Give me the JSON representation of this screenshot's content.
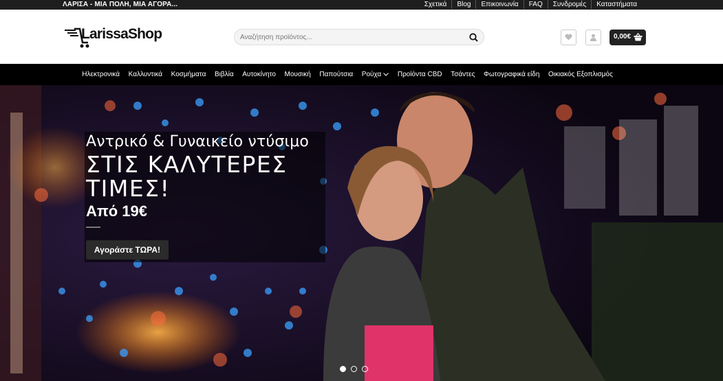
{
  "topbar": {
    "tagline": "ΛΑΡΙΣΑ - ΜΙΑ ΠΟΛΗ, ΜΙΑ ΑΓΟΡΑ...",
    "links": [
      "Σχετικά",
      "Blog",
      "Επικοινωνία",
      "FAQ",
      "Συνδρομές",
      "Καταστήματα"
    ]
  },
  "header": {
    "logo_text": "LarissaShop",
    "search_placeholder": "Αναζήτηση προϊόντος...",
    "cart_total": "0,00€"
  },
  "nav": {
    "items": [
      "Ηλεκτρονικά",
      "Καλλυντικά",
      "Κοσμήματα",
      "Βιβλία",
      "Αυτοκίνητο",
      "Μουσική",
      "Παπούτσια",
      "Ρούχα",
      "Προϊόντα CBD",
      "Τσάντες",
      "Φωτογραφικά είδη",
      "Οικιακός Εξοπλισμός"
    ]
  },
  "hero": {
    "line1": "Αντρικό & Γυναικείο ντύσιμο",
    "line2": "ΣΤΙΣ ΚΑΛΥΤΕΡΕΣ ΤΙΜΕΣ!",
    "line3": "Από 19€",
    "button": "Αγοράστε ΤΩΡΑ!",
    "slide_count": 3,
    "active_slide": 1
  },
  "colors": {
    "topbar_bg": "#1e1e1e",
    "nav_bg": "#000000",
    "cart_bg": "#222222"
  }
}
